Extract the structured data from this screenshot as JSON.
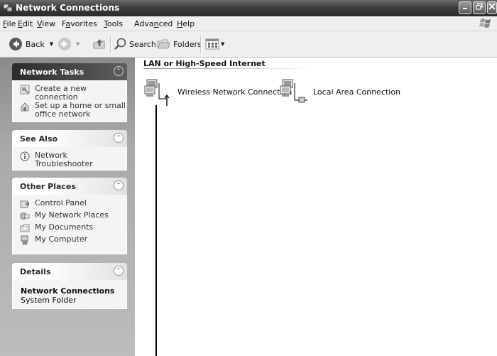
{
  "window": {
    "title": "Network Connections"
  },
  "menu": [
    {
      "pre": "",
      "u": "F",
      "post": "ile"
    },
    {
      "pre": "",
      "u": "E",
      "post": "dit"
    },
    {
      "pre": "",
      "u": "V",
      "post": "iew"
    },
    {
      "pre": "F",
      "u": "a",
      "post": "vorites"
    },
    {
      "pre": "",
      "u": "T",
      "post": "ools"
    },
    {
      "pre": "Adva",
      "u": "n",
      "post": "ced"
    },
    {
      "pre": "",
      "u": "H",
      "post": "elp"
    }
  ],
  "toolbar": {
    "back": "Back",
    "search": "Search",
    "folders": "Folders"
  },
  "tasks": {
    "network_tasks": {
      "title": "Network Tasks",
      "items": [
        "Create a new connection",
        "Set up a home or small office network"
      ]
    },
    "see_also": {
      "title": "See Also",
      "items": [
        "Network Troubleshooter"
      ]
    },
    "other_places": {
      "title": "Other Places",
      "items": [
        "Control Panel",
        "My Network Places",
        "My Documents",
        "My Computer"
      ]
    },
    "details": {
      "title": "Details",
      "name": "Network Connections",
      "type": "System Folder"
    }
  },
  "main": {
    "section_title": "LAN or High-Speed Internet",
    "connections": [
      "Wireless Network Connection",
      "Local Area Connection"
    ]
  },
  "icons": {
    "app": "network-connections-icon",
    "back": "back-arrow-icon",
    "forward": "forward-arrow-icon",
    "up": "up-folder-icon",
    "search": "search-icon",
    "folders": "folders-icon",
    "views": "views-icon"
  }
}
